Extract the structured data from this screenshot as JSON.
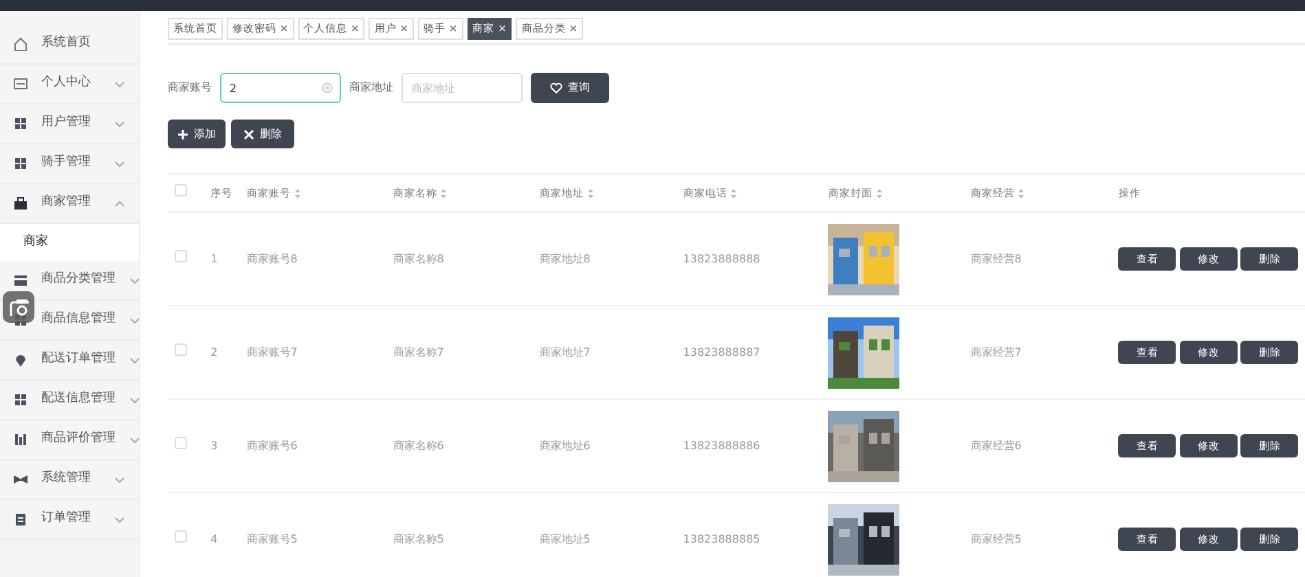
{
  "sidebar": {
    "items": [
      {
        "label": "系统首页"
      },
      {
        "label": "个人中心",
        "expanded": false
      },
      {
        "label": "用户管理",
        "expanded": false
      },
      {
        "label": "骑手管理",
        "expanded": false
      },
      {
        "label": "商家管理",
        "expanded": true,
        "children": [
          {
            "label": "商家",
            "selected": true
          }
        ]
      },
      {
        "label": "商品分类管理",
        "expanded": false
      },
      {
        "label": "商品信息管理",
        "expanded": false
      },
      {
        "label": "配送订单管理",
        "expanded": false
      },
      {
        "label": "配送信息管理",
        "expanded": false
      },
      {
        "label": "商品评价管理",
        "expanded": false
      },
      {
        "label": "系统管理",
        "expanded": false
      },
      {
        "label": "订单管理",
        "expanded": false
      }
    ]
  },
  "tabs": [
    {
      "label": "系统首页",
      "selected": false
    },
    {
      "label": "修改密码",
      "close": "×",
      "selected": false
    },
    {
      "label": "个人信息",
      "close": "×",
      "selected": false
    },
    {
      "label": "用户",
      "close": "×",
      "selected": false
    },
    {
      "label": "骑手",
      "close": "×",
      "selected": false
    },
    {
      "label": "商家",
      "close": "×",
      "selected": true
    },
    {
      "label": "商品分类",
      "close": "×",
      "selected": false
    }
  ],
  "search": {
    "account_label": "商家账号",
    "account_value": "2",
    "address_label": "商家地址",
    "address_placeholder": "商家地址",
    "query_button": "查询"
  },
  "actions": {
    "add": "添加",
    "delete": "删除"
  },
  "table": {
    "all_checked": false,
    "columns": [
      {
        "label": "序号",
        "kind": "plain"
      },
      {
        "label": "商家账号",
        "kind": "sortable"
      },
      {
        "label": "商家名称",
        "kind": "sortable"
      },
      {
        "label": "商家地址",
        "kind": "sortable"
      },
      {
        "label": "商家电话",
        "kind": "sortable"
      },
      {
        "label": "商家封面",
        "kind": "sortable"
      },
      {
        "label": "商家经营",
        "kind": "sortable"
      },
      {
        "label": "操作",
        "kind": "plain"
      }
    ],
    "rows": [
      {
        "checked": false,
        "index": "1",
        "account": "商家账号8",
        "name": "商家名称8",
        "address": "商家地址8",
        "phone": "13823888888",
        "cover": {
          "kind": "picture"
        },
        "business": "商家经营8",
        "buttons": [
          "查看",
          "修改",
          "删除"
        ]
      },
      {
        "checked": false,
        "index": "2",
        "account": "商家账号7",
        "name": "商家名称7",
        "address": "商家地址7",
        "phone": "13823888887",
        "cover": {
          "kind": "picture"
        },
        "business": "商家经营7",
        "buttons": [
          "查看",
          "修改",
          "删除"
        ]
      },
      {
        "checked": false,
        "index": "3",
        "account": "商家账号6",
        "name": "商家名称6",
        "address": "商家地址6",
        "phone": "13823888886",
        "cover": {
          "kind": "picture"
        },
        "business": "商家经营6",
        "buttons": [
          "查看",
          "修改",
          "删除"
        ]
      },
      {
        "checked": false,
        "index": "4",
        "account": "商家账号5",
        "name": "商家名称5",
        "address": "商家地址5",
        "phone": "13823888885",
        "cover": {
          "kind": "picture"
        },
        "business": "商家经营5",
        "buttons": [
          "查看",
          "修改",
          "删除"
        ]
      }
    ]
  }
}
